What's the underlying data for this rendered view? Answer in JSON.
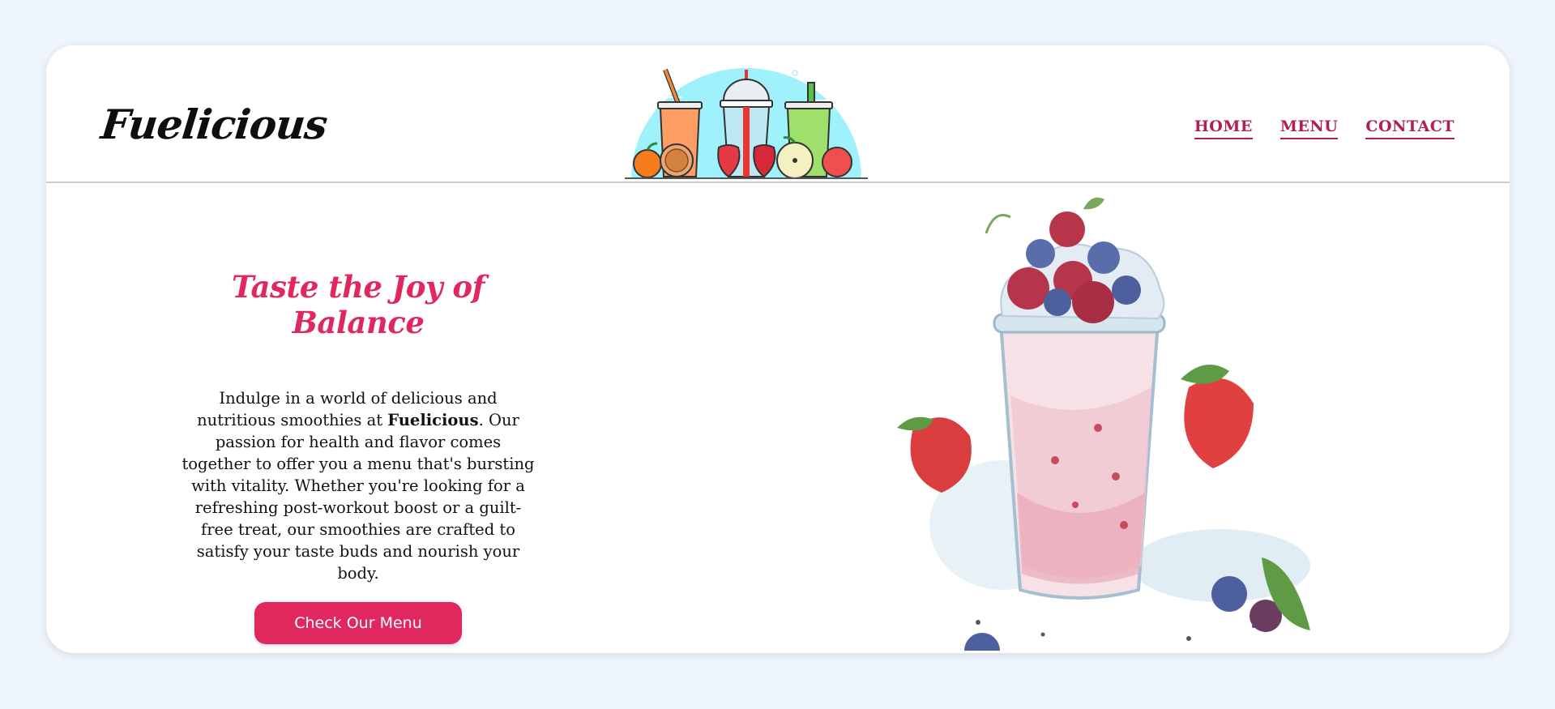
{
  "brand": {
    "name": "Fuelicious",
    "accent": "#e0285e",
    "nav_color": "#b11d54"
  },
  "nav": {
    "items": [
      {
        "label": "HOME"
      },
      {
        "label": "MENU"
      },
      {
        "label": "CONTACT"
      }
    ]
  },
  "hero": {
    "title": "Taste the Joy of Balance",
    "text_before": "Indulge in a world of delicious and nutritious smoothies at ",
    "text_bold": "Fuelicious",
    "text_after": ". Our passion for health and flavor comes together to offer you a menu that's bursting with vitality. Whether you're looking for a refreshing post-workout boost or a guilt-free treat, our smoothies are crafted to satisfy your taste buds and nourish your body.",
    "cta_label": "Check Our Menu"
  },
  "images": {
    "header_illustration": "smoothie-cups-illustration",
    "hero_illustration": "berry-smoothie-watercolor"
  }
}
